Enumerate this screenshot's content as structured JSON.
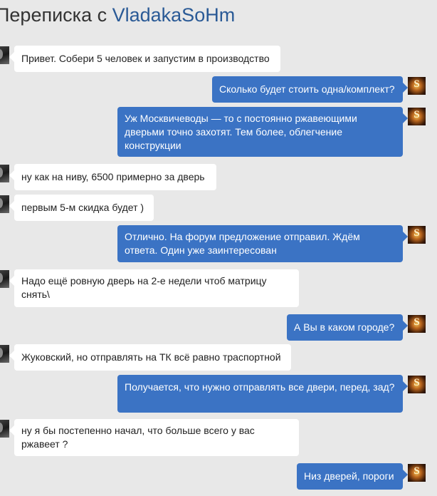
{
  "header": {
    "title_prefix": "Переписка с",
    "username": "VladakaSoHm"
  },
  "my_avatar_letter": "S",
  "messages": [
    {
      "direction": "in",
      "text": "Привет. Собери 5 человек и запустим в производство"
    },
    {
      "direction": "out",
      "text": "Сколько будет стоить одна/комплект?"
    },
    {
      "direction": "out",
      "text": "Уж Москвичеводы — то с постоянно ржавеющими дверьми точно захотят. Тем более, облегчение конструкции"
    },
    {
      "direction": "in",
      "text": "ну как на ниву, 6500 примерно за дверь"
    },
    {
      "direction": "in",
      "text": "первым 5-м скидка будет )"
    },
    {
      "direction": "out",
      "text": "Отлично. На форум предложение отправил. Ждём ответа. Один уже заинтересован"
    },
    {
      "direction": "in",
      "text": "Надо ещё ровную дверь на 2-е недели чтоб матрицу снять\\"
    },
    {
      "direction": "out",
      "text": "А Вы в каком городе?"
    },
    {
      "direction": "in",
      "text": "Жуковский, но отправлять на ТК всё равно траспортной"
    },
    {
      "direction": "out",
      "text": "Получается, что нужно отправлять все двери, перед, зад?"
    },
    {
      "direction": "in",
      "text": "ну я бы постепенно начал, что больше всего у вас ржавеет ?"
    },
    {
      "direction": "out",
      "text": "Низ дверей, пороги"
    }
  ]
}
